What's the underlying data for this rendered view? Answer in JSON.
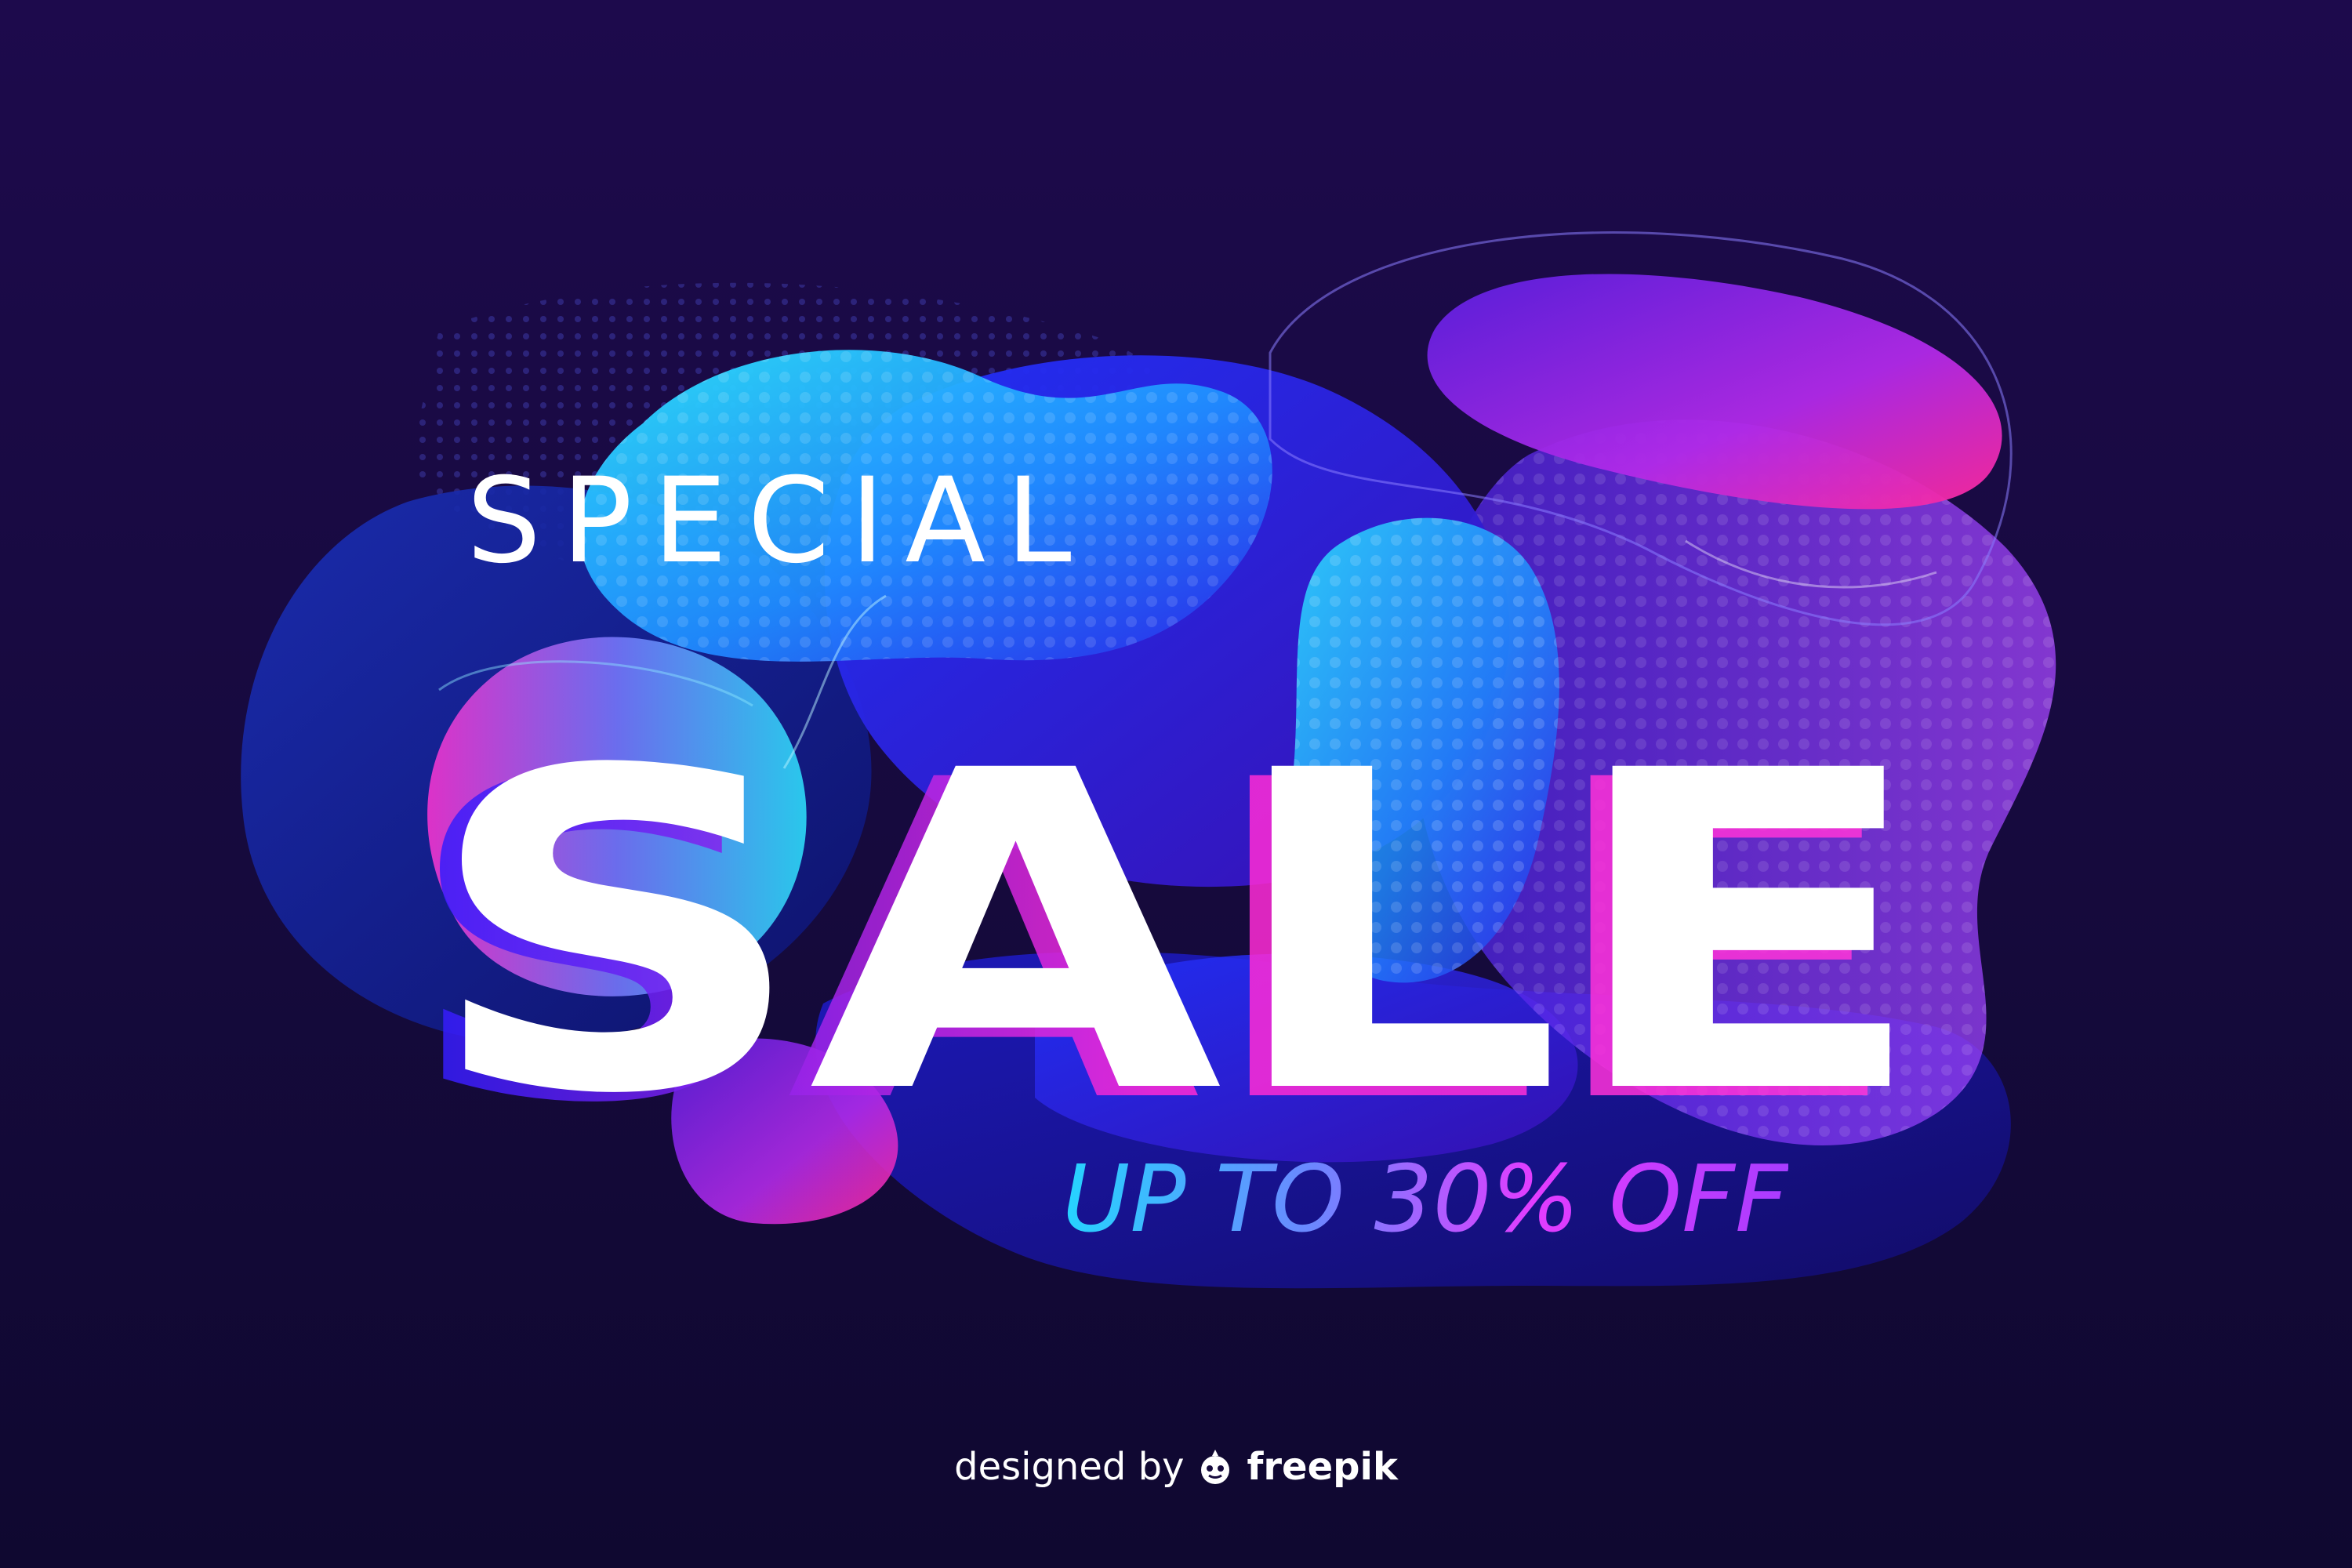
{
  "banner": {
    "headline_small": "SPECIAL",
    "headline_big": "SALE",
    "offer": "UP TO 30% OFF"
  },
  "credit": {
    "prefix": "designed by",
    "brand": "freepik",
    "icon": "freepik-logo-icon"
  },
  "colors": {
    "background": "#160a3d",
    "cyan": "#25d4ff",
    "blue": "#2a25e8",
    "magenta": "#e62ad0",
    "purple": "#7a3cff",
    "text": "#ffffff"
  }
}
